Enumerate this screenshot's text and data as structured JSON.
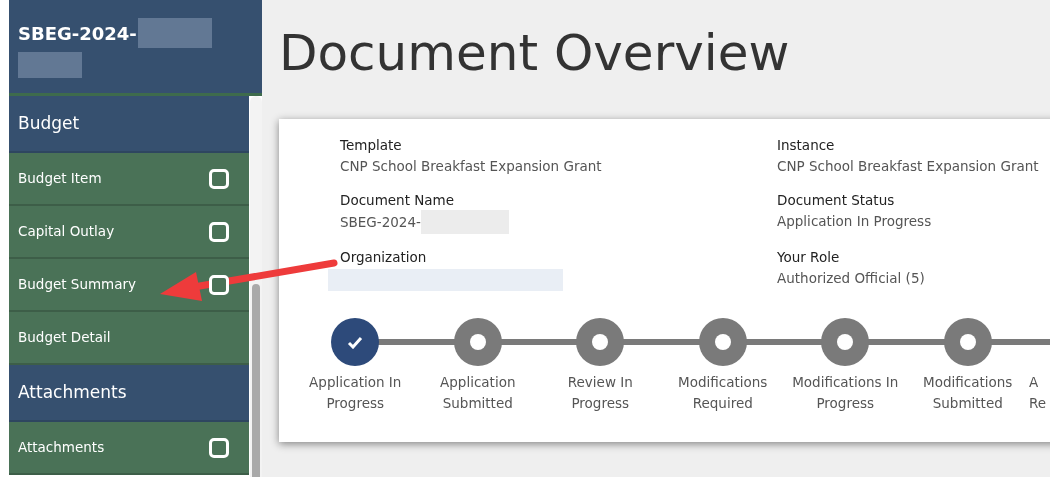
{
  "sidebar": {
    "title": "SBEG-2024-",
    "sections": [
      {
        "heading": "Budget",
        "items": [
          {
            "label": "Budget Item",
            "checked": false
          },
          {
            "label": "Capital Outlay",
            "checked": false
          },
          {
            "label": "Budget Summary",
            "checked": false
          },
          {
            "label": "Budget Detail"
          }
        ]
      },
      {
        "heading": "Attachments",
        "items": [
          {
            "label": "Attachments",
            "checked": false
          }
        ]
      }
    ]
  },
  "page_title": "Document Overview",
  "details": [
    {
      "label": "Template",
      "value": "CNP School Breakfast Expansion Grant"
    },
    {
      "label": "Instance",
      "value": "CNP School Breakfast Expansion Grant"
    },
    {
      "label": "Document Name",
      "value": "SBEG-2024-",
      "redacted": true
    },
    {
      "label": "Document Status",
      "value": "Application In Progress"
    },
    {
      "label": "Organization",
      "redacted": true
    },
    {
      "label": "Your Role",
      "value": "Authorized Official (5)"
    }
  ],
  "steps": [
    {
      "kind": "step",
      "lines": [
        "Application In",
        "Progress"
      ],
      "completed": true
    },
    {
      "kind": "step",
      "lines": [
        "Application",
        "Submitted"
      ],
      "completed": false
    },
    {
      "kind": "step",
      "lines": [
        "Review In",
        "Progress"
      ],
      "completed": false
    },
    {
      "kind": "step",
      "lines": [
        "Modifications",
        "Required"
      ],
      "completed": false
    },
    {
      "kind": "step",
      "lines": [
        "Modifications In",
        "Progress"
      ],
      "completed": false
    },
    {
      "kind": "step",
      "lines": [
        "Modifications",
        "Submitted"
      ],
      "completed": false
    },
    {
      "kind": "partial",
      "lines": [
        "A",
        "Re"
      ]
    }
  ]
}
